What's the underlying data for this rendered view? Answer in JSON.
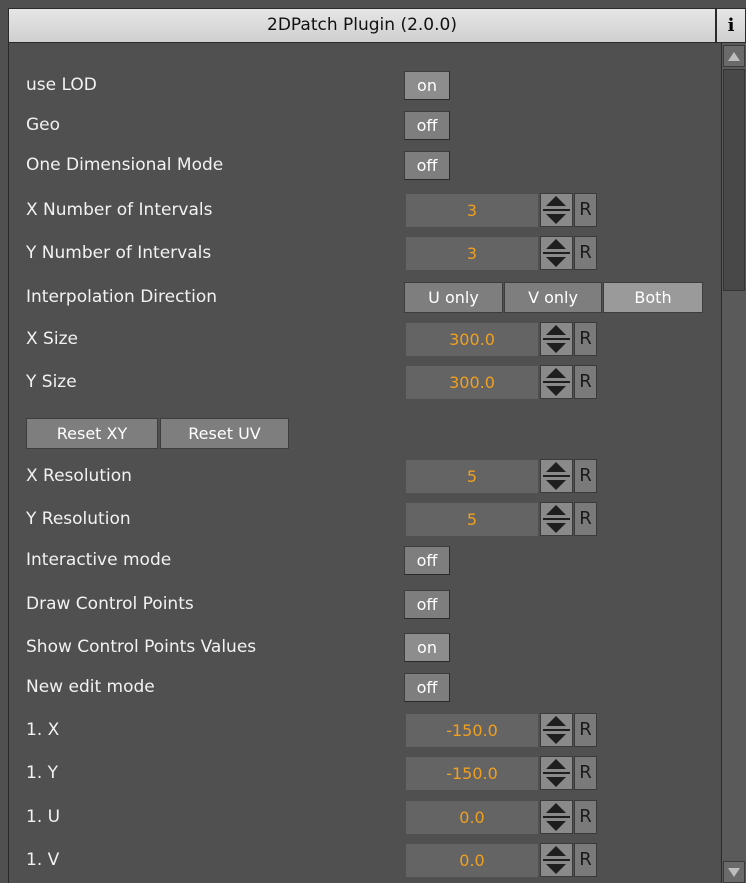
{
  "title": "2DPatch Plugin (2.0.0)",
  "info_label": "i",
  "colors": {
    "background": "#505050",
    "value_text": "#f0a020",
    "title_bg": "#dcdcdc"
  },
  "rows": {
    "use_lod": {
      "label": "use LOD",
      "value": "on"
    },
    "geo": {
      "label": "Geo",
      "value": "off"
    },
    "one_dim": {
      "label": "One Dimensional Mode",
      "value": "off"
    },
    "x_intervals": {
      "label": "X Number of Intervals",
      "value": "3"
    },
    "y_intervals": {
      "label": "Y Number of Intervals",
      "value": "3"
    },
    "interp_dir": {
      "label": "Interpolation Direction",
      "options": [
        "U only",
        "V only",
        "Both"
      ],
      "selected": "Both"
    },
    "x_size": {
      "label": "X Size",
      "value": "300.0"
    },
    "y_size": {
      "label": "Y Size",
      "value": "300.0"
    },
    "reset_xy": "Reset XY",
    "reset_uv": "Reset UV",
    "x_res": {
      "label": "X Resolution",
      "value": "5"
    },
    "y_res": {
      "label": "Y Resolution",
      "value": "5"
    },
    "interactive": {
      "label": "Interactive mode",
      "value": "off"
    },
    "draw_cp": {
      "label": "Draw Control Points",
      "value": "off"
    },
    "show_cp_vals": {
      "label": "Show Control Points Values",
      "value": "on"
    },
    "new_edit": {
      "label": "New edit mode",
      "value": "off"
    },
    "p1x": {
      "label": "1. X",
      "value": "-150.0"
    },
    "p1y": {
      "label": "1. Y",
      "value": "-150.0"
    },
    "p1u": {
      "label": "1. U",
      "value": "0.0"
    },
    "p1v": {
      "label": "1. V",
      "value": "0.0"
    }
  },
  "reset_label": "R"
}
